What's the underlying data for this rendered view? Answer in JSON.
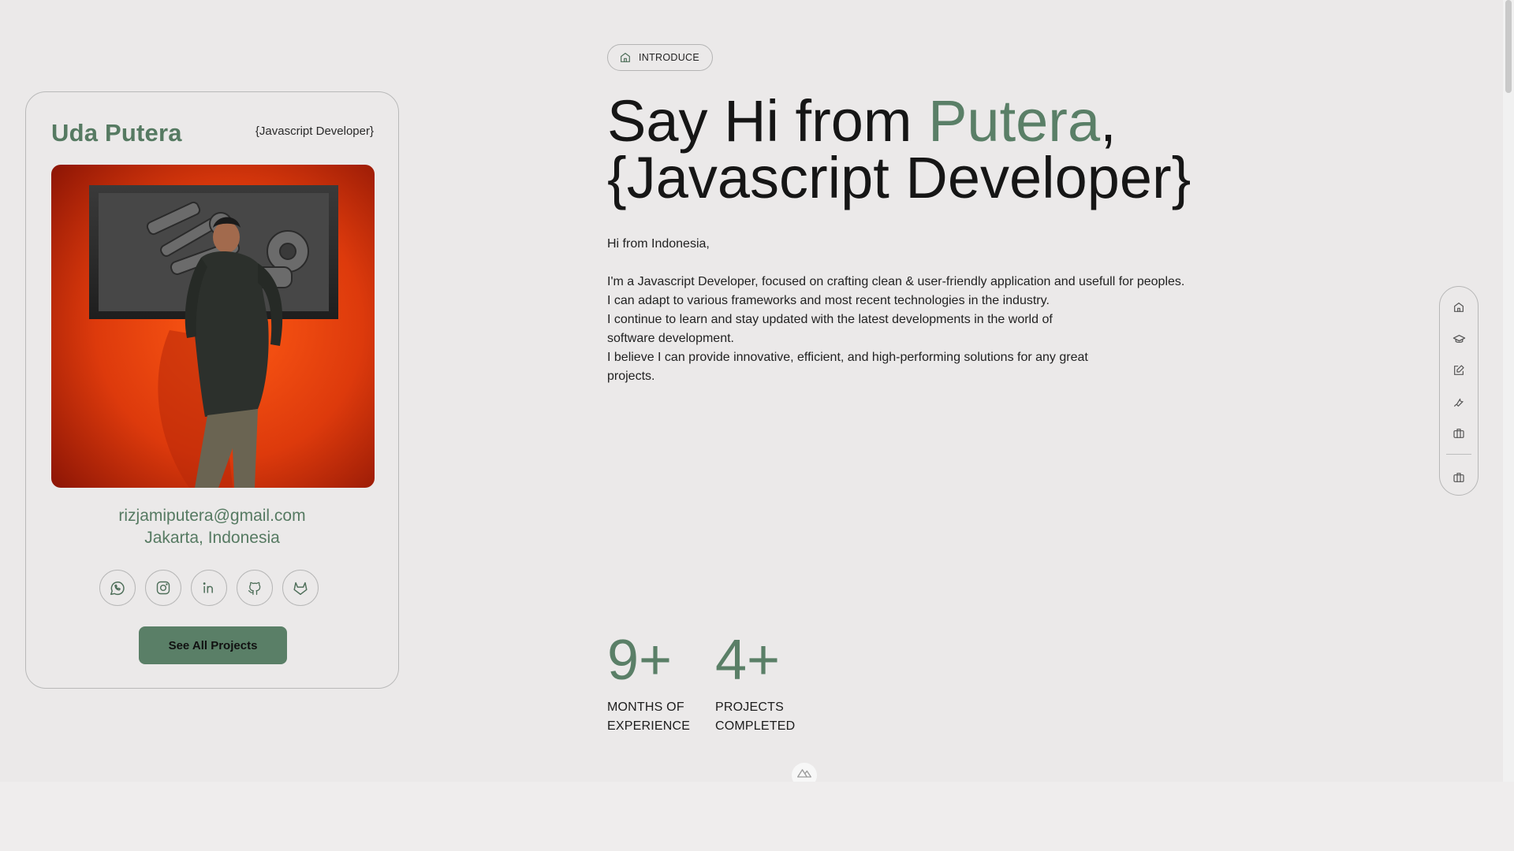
{
  "profile": {
    "name": "Uda Putera",
    "role": "{Javascript Developer}",
    "email": "rizjamiputera@gmail.com",
    "location": "Jakarta, Indonesia",
    "socials": [
      "whatsapp-icon",
      "instagram-icon",
      "linkedin-icon",
      "github-icon",
      "gitlab-icon"
    ],
    "cta_label": "See All Projects"
  },
  "hero": {
    "badge_label": "INTRODUCE",
    "title_prefix": "Say Hi from ",
    "title_accent": "Putera",
    "title_comma": ",",
    "title_line2": "{Javascript Developer}",
    "greeting": "Hi from Indonesia,",
    "bio_lines": [
      "I'm a Javascript Developer, focused on crafting clean & user-friendly application and usefull for peoples.",
      "I can adapt to various frameworks and most recent technologies in the industry.",
      "I continue to learn and stay updated with the latest developments in the world of",
      "software development.",
      "I believe I can provide innovative, efficient, and high-performing solutions for any great",
      "projects."
    ]
  },
  "stats": [
    {
      "value": "9+",
      "label_line1": "MONTHS OF",
      "label_line2": "EXPERIENCE"
    },
    {
      "value": "4+",
      "label_line1": "PROJECTS",
      "label_line2": "COMPLETED"
    }
  ],
  "side_nav": {
    "items": [
      "home-icon",
      "graduation-cap-icon",
      "edit-icon",
      "tools-icon",
      "briefcase-icon"
    ],
    "footer_item": "briefcase-icon"
  },
  "colors": {
    "accent": "#5a7f67",
    "background": "#ebe9e9",
    "border": "#b7b7b7"
  }
}
